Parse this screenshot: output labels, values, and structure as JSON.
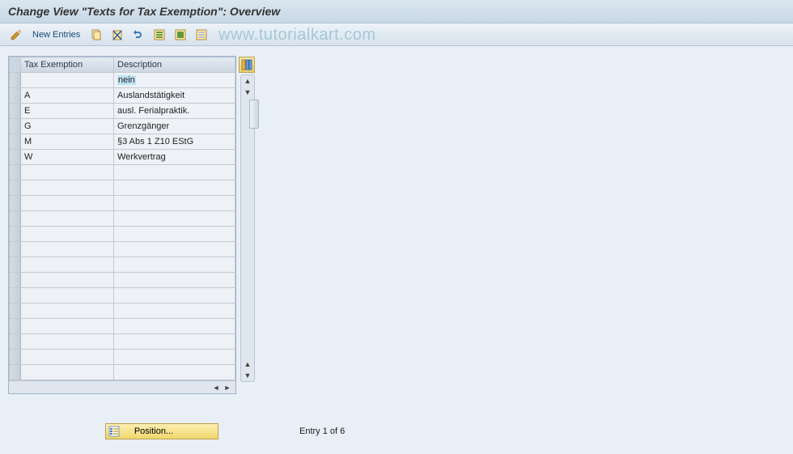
{
  "title": "Change View \"Texts for Tax Exemption\": Overview",
  "toolbar": {
    "new_entries_label": "New Entries"
  },
  "watermark": "www.tutorialkart.com",
  "table": {
    "headers": {
      "col1": "Tax Exemption",
      "col2": "Description"
    },
    "rows": [
      {
        "code": "",
        "desc": "nein",
        "highlight": true
      },
      {
        "code": "A",
        "desc": "Auslandstätigkeit"
      },
      {
        "code": "E",
        "desc": "ausl. Ferialpraktik."
      },
      {
        "code": "G",
        "desc": "Grenzgänger"
      },
      {
        "code": "M",
        "desc": "§3 Abs 1 Z10 EStG"
      },
      {
        "code": "W",
        "desc": "Werkvertrag"
      }
    ],
    "empty_row_count": 14
  },
  "footer": {
    "position_label": "Position...",
    "entry_text": "Entry 1 of 6"
  }
}
